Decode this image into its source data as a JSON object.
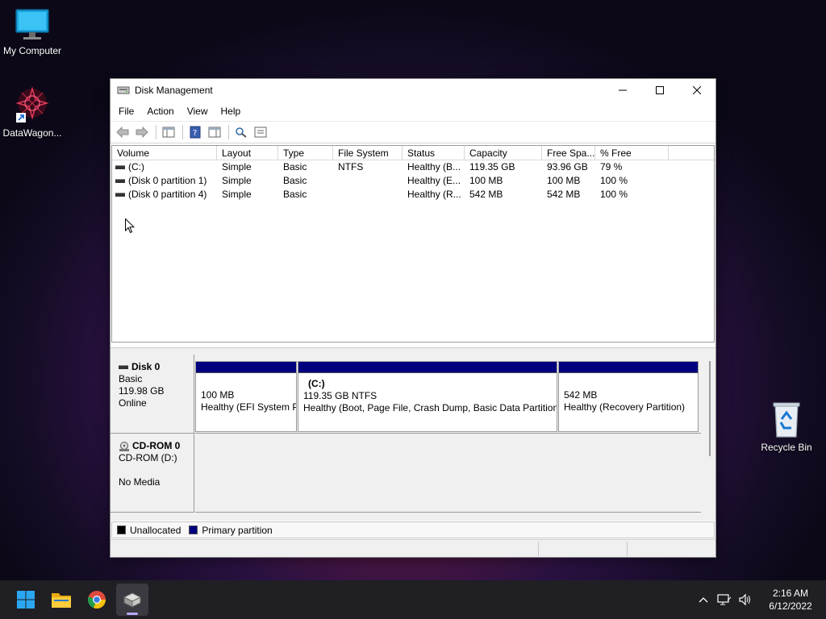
{
  "desktop": {
    "icons": [
      {
        "label": "My Computer"
      },
      {
        "label": "DataWagon..."
      },
      {
        "label": "Recycle Bin"
      }
    ]
  },
  "window": {
    "title": "Disk Management",
    "menu": [
      "File",
      "Action",
      "View",
      "Help"
    ]
  },
  "volume_list": {
    "columns": [
      "Volume",
      "Layout",
      "Type",
      "File System",
      "Status",
      "Capacity",
      "Free Spa...",
      "% Free"
    ],
    "rows": [
      [
        "(C:)",
        "Simple",
        "Basic",
        "NTFS",
        "Healthy (B...",
        "119.35 GB",
        "93.96 GB",
        "79 %"
      ],
      [
        "(Disk 0 partition 1)",
        "Simple",
        "Basic",
        "",
        "Healthy (E...",
        "100 MB",
        "100 MB",
        "100 %"
      ],
      [
        "(Disk 0 partition 4)",
        "Simple",
        "Basic",
        "",
        "Healthy (R...",
        "542 MB",
        "542 MB",
        "100 %"
      ]
    ]
  },
  "disks": {
    "disk0": {
      "name": "Disk 0",
      "type": "Basic",
      "size": "119.98 GB",
      "status": "Online",
      "partitions": [
        {
          "line1": "100 MB",
          "line2": "Healthy (EFI System Partition)"
        },
        {
          "label": "(C:)",
          "line1": "119.35 GB NTFS",
          "line2": "Healthy (Boot, Page File, Crash Dump, Basic Data Partition)"
        },
        {
          "line1": "542 MB",
          "line2": "Healthy (Recovery Partition)"
        }
      ]
    },
    "cdrom0": {
      "name": "CD-ROM 0",
      "drive": "CD-ROM (D:)",
      "status": "No Media"
    }
  },
  "legend": {
    "unallocated": "Unallocated",
    "primary": "Primary partition",
    "unallocated_color": "#000000",
    "primary_color": "#00007f"
  },
  "taskbar": {
    "apps": [
      "start-icon",
      "file-explorer-icon",
      "chrome-icon",
      "disk-management-icon"
    ],
    "clock": {
      "time": "2:16 AM",
      "date": "6/12/2022"
    }
  }
}
